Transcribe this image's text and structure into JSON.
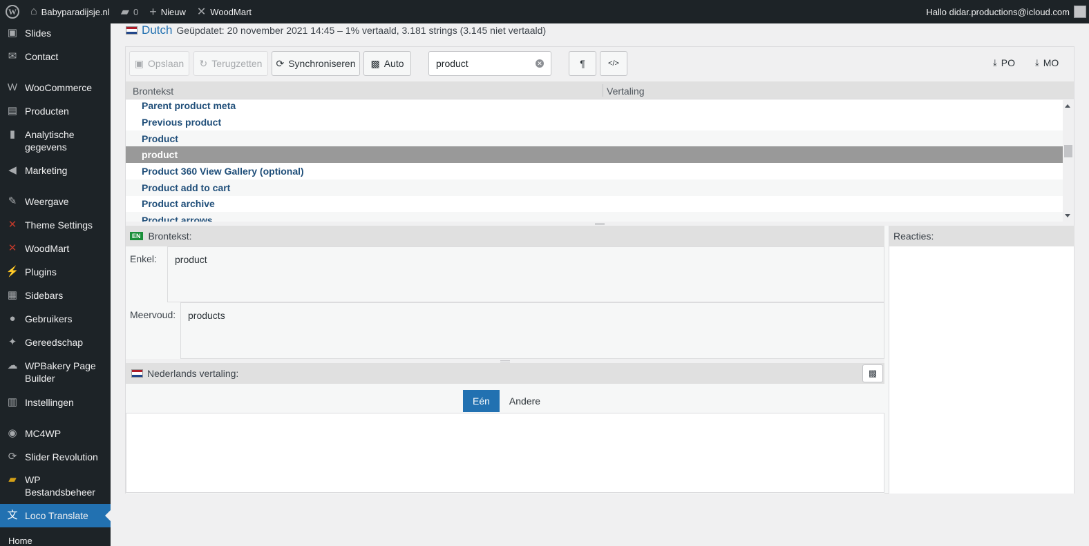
{
  "adminbar": {
    "site_name": "Babyparadijsje.nl",
    "comments_count": "0",
    "new_label": "Nieuw",
    "woodmart_label": "WoodMart",
    "greeting": "Hallo didar.productions@icloud.com"
  },
  "sidebar": {
    "items": [
      {
        "label": "Slides",
        "icon": "slides-icon",
        "glyph": "▣"
      },
      {
        "label": "Contact",
        "icon": "mail-icon",
        "glyph": "✉"
      },
      {
        "label": "WooCommerce",
        "icon": "woocommerce-icon",
        "glyph": "W"
      },
      {
        "label": "Producten",
        "icon": "archive-icon",
        "glyph": "▤"
      },
      {
        "label": "Analytische gegevens",
        "icon": "chart-bar-icon",
        "glyph": "▮"
      },
      {
        "label": "Marketing",
        "icon": "megaphone-icon",
        "glyph": "◀"
      },
      {
        "label": "Weergave",
        "icon": "brush-icon",
        "glyph": "✎"
      },
      {
        "label": "Theme Settings",
        "icon": "woodmart-x-icon",
        "glyph": "✕"
      },
      {
        "label": "WoodMart",
        "icon": "woodmart-x-icon",
        "glyph": "✕"
      },
      {
        "label": "Plugins",
        "icon": "plug-icon",
        "glyph": "⚡"
      },
      {
        "label": "Sidebars",
        "icon": "layout-icon",
        "glyph": "▦"
      },
      {
        "label": "Gebruikers",
        "icon": "user-icon",
        "glyph": "●"
      },
      {
        "label": "Gereedschap",
        "icon": "wrench-icon",
        "glyph": "✦"
      },
      {
        "label": "WPBakery Page Builder",
        "icon": "wpbakery-icon",
        "glyph": "☁"
      },
      {
        "label": "Instellingen",
        "icon": "settings-icon",
        "glyph": "▥"
      },
      {
        "label": "MC4WP",
        "icon": "mc4wp-icon",
        "glyph": "◉"
      },
      {
        "label": "Slider Revolution",
        "icon": "refresh-icon",
        "glyph": "⟳"
      },
      {
        "label": "WP Bestandsbeheer",
        "icon": "folder-icon",
        "glyph": "▰"
      },
      {
        "label": "Loco Translate",
        "icon": "translate-icon",
        "glyph": "文"
      }
    ],
    "sub_home": "Home"
  },
  "status": {
    "language": "Dutch",
    "details": "Geüpdatet: 20 november 2021 14:45 – 1% vertaald, 3.181 strings (3.145 niet vertaald)"
  },
  "toolbar": {
    "save_label": "Opslaan",
    "revert_label": "Terugzetten",
    "sync_label": "Synchroniseren",
    "auto_label": "Auto",
    "search_value": "product",
    "pilcrow_label": "¶",
    "code_label": "</>",
    "po_label": "PO",
    "mo_label": "MO"
  },
  "list": {
    "col_source": "Brontekst",
    "col_translation": "Vertaling",
    "rows": [
      "Parent product meta",
      "Previous product",
      "Product",
      "product",
      "Product 360 View Gallery (optional)",
      "Product add to cart",
      "Product archive",
      "Product arrows"
    ]
  },
  "source": {
    "badge": "EN",
    "title": "Brontekst:",
    "singular_label": "Enkel:",
    "singular_value": "product",
    "plural_label": "Meervoud:",
    "plural_value": "products"
  },
  "translation": {
    "title": "Nederlands vertaling:",
    "tab_one": "Eén",
    "tab_other": "Andere"
  },
  "comments": {
    "title": "Reacties:"
  },
  "colors": {
    "admin_dark": "#1d2327",
    "accent": "#2271b1",
    "selected_row": "#999999",
    "row_text": "#1f4e79"
  }
}
